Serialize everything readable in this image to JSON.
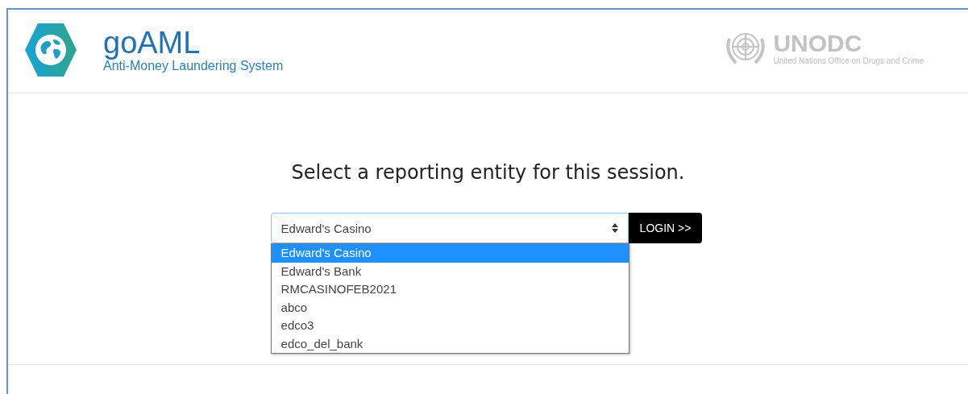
{
  "header": {
    "app_name": "goAML",
    "app_subtitle": "Anti-Money Laundering System",
    "org_name": "UNODC",
    "org_subtitle": "United Nations Office on Drugs and Crime"
  },
  "heading": "Select a reporting entity for this session.",
  "entity_select": {
    "value": "Edward's Casino",
    "expanded": true,
    "options": [
      {
        "label": "Edward's Casino",
        "selected": true
      },
      {
        "label": "Edward's Bank",
        "selected": false
      },
      {
        "label": "RMCASINOFEB2021",
        "selected": false
      },
      {
        "label": "abco",
        "selected": false
      },
      {
        "label": "edco3",
        "selected": false
      },
      {
        "label": "edco_del_bank",
        "selected": false
      }
    ]
  },
  "login_button": "LOGIN >>"
}
